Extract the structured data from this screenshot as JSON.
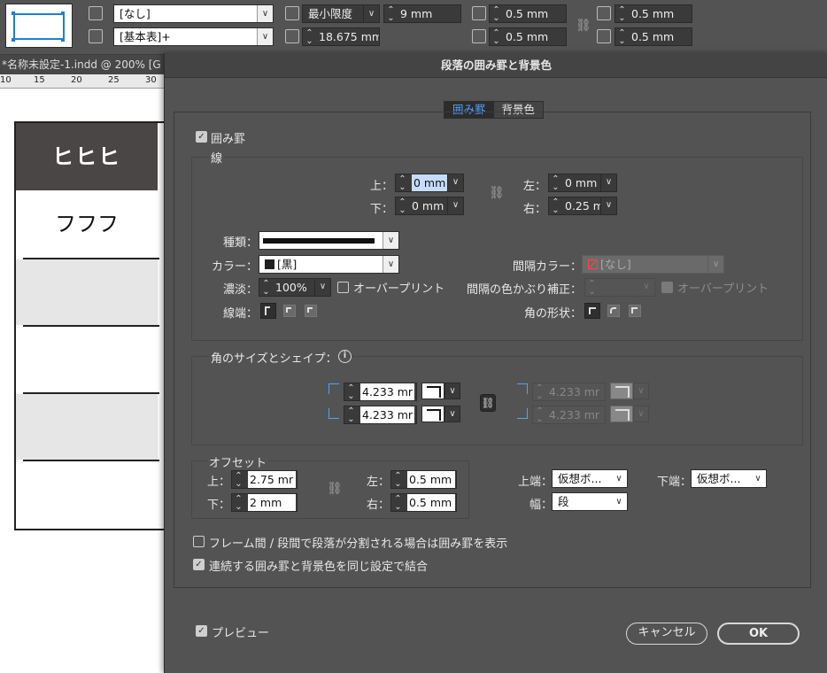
{
  "control_panel": {
    "style1": "[なし]",
    "style2": "[基本表]+",
    "height_mode": "最小限度",
    "row_height": "9 mm",
    "col_width": "18.675 mm",
    "inset_top": "0.5 mm",
    "inset_bottom": "0.5 mm",
    "inset_left": "0.5 mm",
    "inset_right": "0.5 mm"
  },
  "document": {
    "tab_title": "*名称未設定-1.indd @ 200% [G",
    "ruler_ticks": [
      "10",
      "15",
      "20",
      "25",
      "30"
    ],
    "header_text": "ヒヒヒ",
    "row1_text": "フフフ"
  },
  "dialog": {
    "title": "段落の囲み罫と背景色",
    "tabs": [
      "囲み罫",
      "背景色"
    ],
    "border_checkbox": "囲み罫",
    "stroke_section": "線",
    "top_label": "上：",
    "top_value": "0 mm",
    "bottom_label": "下：",
    "bottom_value": "0 mm",
    "left_label": "左：",
    "left_value": "0 mm",
    "right_label": "右：",
    "right_value": "0.25 m",
    "type_label": "種類：",
    "color_label": "カラー：",
    "color_value": "[黒]",
    "tint_label": "濃淡：",
    "tint_value": "100%",
    "overprint": "オーバープリント",
    "cap_label": "線端：",
    "gap_color_label": "間隔カラー：",
    "gap_color_value": "[なし]",
    "gap_tint_label": "間隔の色かぶり補正：",
    "gap_overprint": "オーバープリント",
    "join_label": "角の形状：",
    "corner_section": "角のサイズとシェイプ：",
    "corner_tl": "4.233 mr",
    "corner_bl": "4.233 mr",
    "corner_tr": "4.233 mr",
    "corner_br": "4.233 mr",
    "offset_section": "オフセット",
    "off_top_label": "上：",
    "off_top_value": "2.75 mr",
    "off_bottom_label": "下：",
    "off_bottom_value": "2 mm",
    "off_left_label": "左：",
    "off_left_value": "0.5 mm",
    "off_right_label": "右：",
    "off_right_value": "0.5 mm",
    "top_edge_label": "上端：",
    "top_edge_value": "仮想ボ...",
    "bottom_edge_label": "下端：",
    "bottom_edge_value": "仮想ボ...",
    "width_label": "幅：",
    "width_value": "段",
    "split_option": "フレーム間 / 段間で段落が分割される場合は囲み罫を表示",
    "merge_option": "連続する囲み罫と背景色を同じ設定で結合",
    "preview": "プレビュー",
    "cancel": "キャンセル",
    "ok": "OK"
  }
}
